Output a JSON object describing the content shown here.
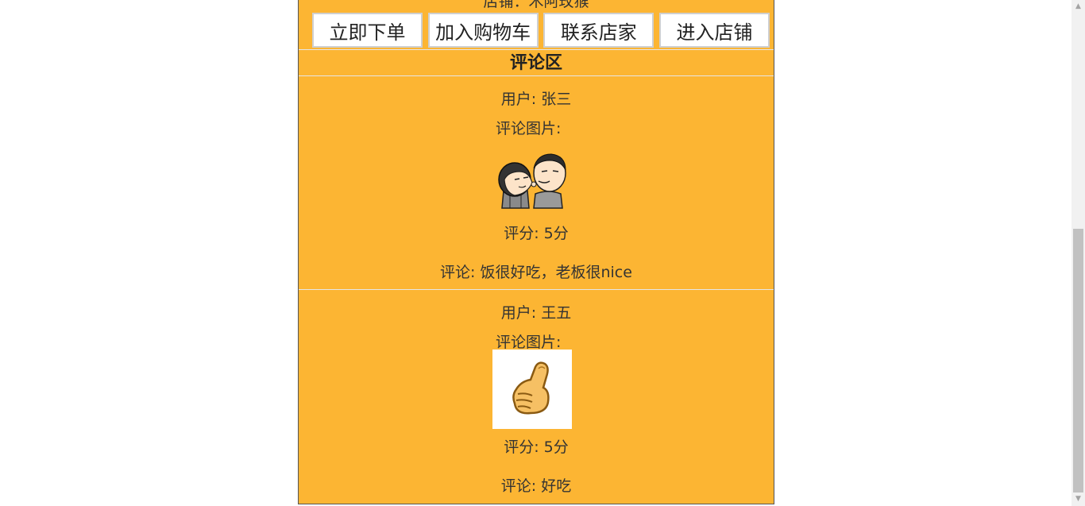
{
  "store": {
    "label": "店铺：木阿玫猴"
  },
  "actions": {
    "order": "立即下单",
    "cart": "加入购物车",
    "contact": "联系店家",
    "enter_store": "进入店铺"
  },
  "comments_section": {
    "title": "评论区",
    "items": [
      {
        "user": "用户: 张三",
        "image_label": "评论图片:",
        "image_icon": "cartoon-faces-meme",
        "score": "评分: 5分",
        "text": "评论: 饭很好吃，老板很nice"
      },
      {
        "user": "用户: 王五",
        "image_label": "评论图片:",
        "image_icon": "thumbs-up",
        "score": "评分: 5分",
        "text": "评论: 好吃"
      }
    ]
  },
  "colors": {
    "panel": "#fcb533",
    "button_bg": "#ffffff",
    "page_bg": "#ffffff"
  }
}
